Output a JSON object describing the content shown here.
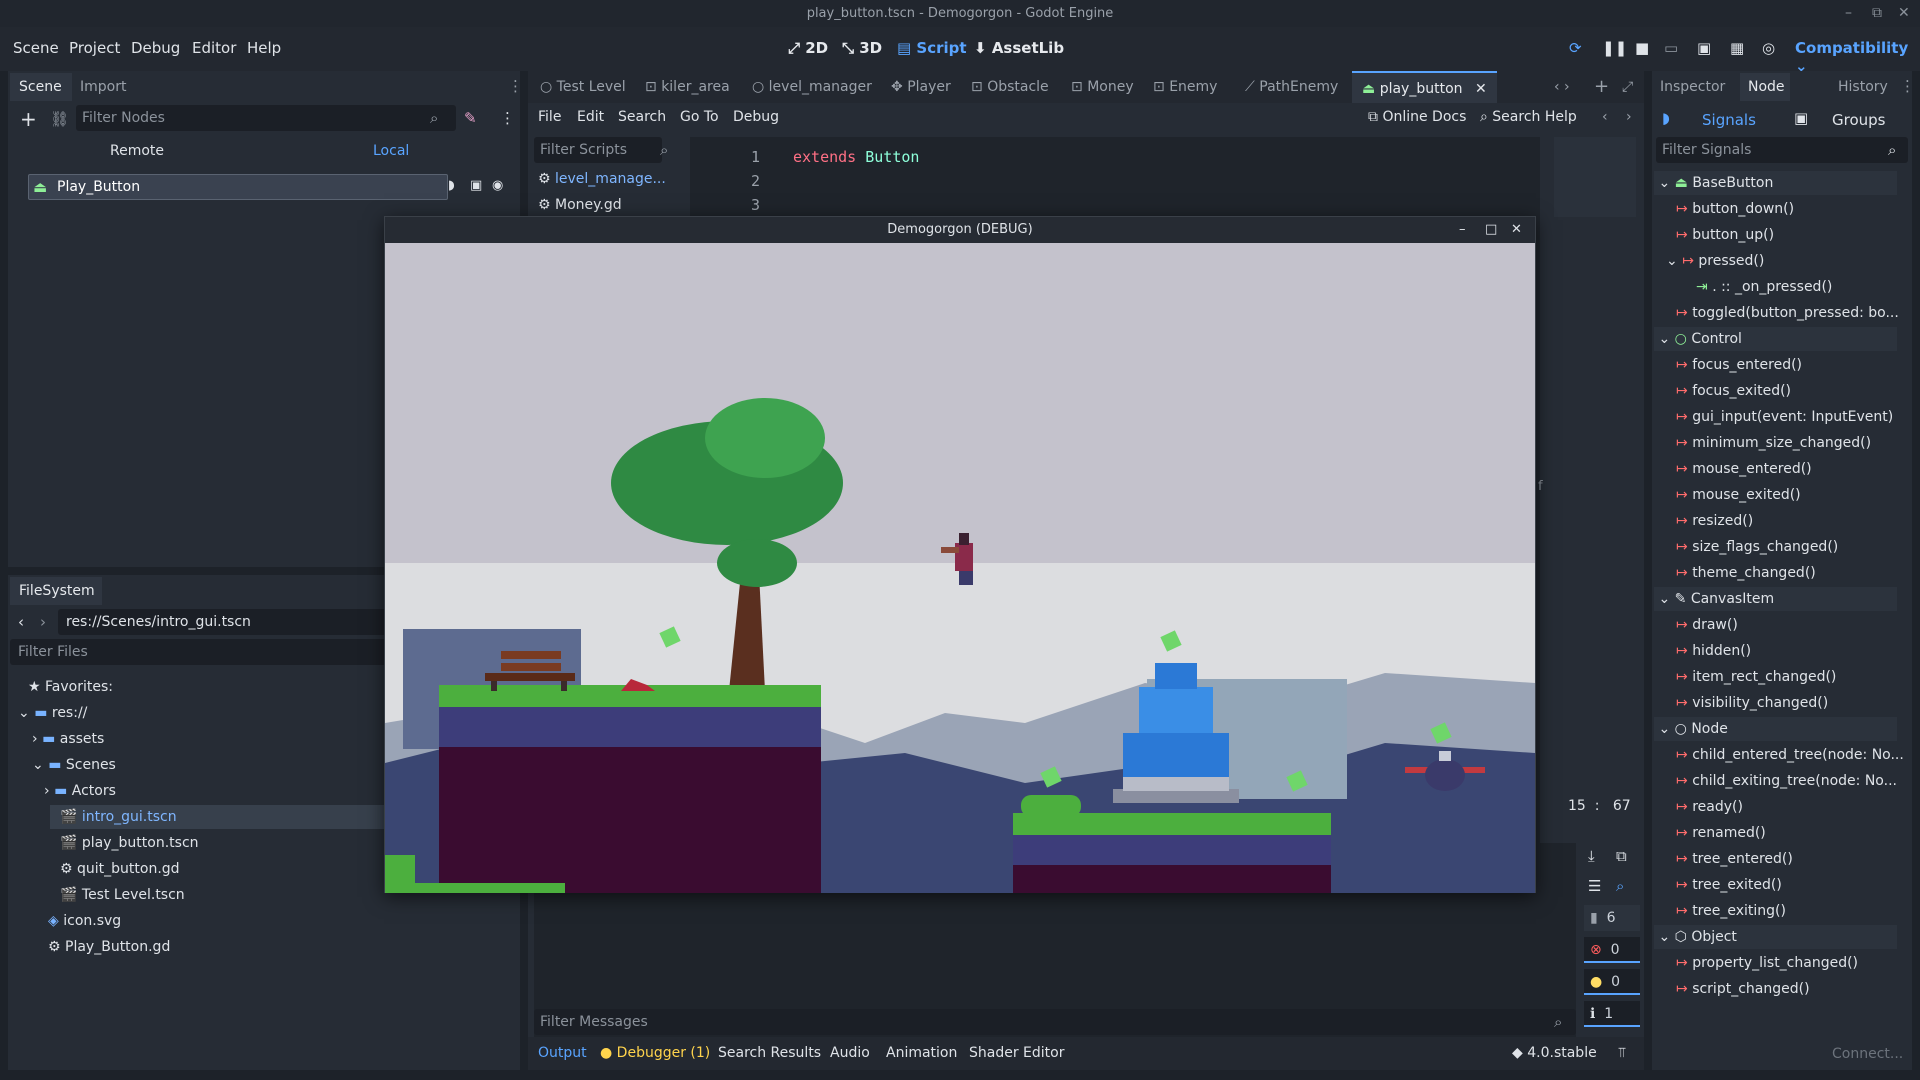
{
  "window": {
    "title": "play_button.tscn - Demogorgon - Godot Engine"
  },
  "menu": [
    "Scene",
    "Project",
    "Debug",
    "Editor",
    "Help"
  ],
  "workspaces": [
    {
      "label": "2D",
      "icon": "2d-icon"
    },
    {
      "label": "3D",
      "icon": "3d-icon"
    },
    {
      "label": "Script",
      "icon": "script-icon"
    },
    {
      "label": "AssetLib",
      "icon": "assetlib-icon"
    }
  ],
  "renderer": "Compatibility",
  "scene_dock": {
    "tabs": [
      "Scene",
      "Import"
    ],
    "filter_placeholder": "Filter Nodes",
    "remote": "Remote",
    "local": "Local",
    "root_node": "Play_Button"
  },
  "filesystem": {
    "tab": "FileSystem",
    "path": "res://Scenes/intro_gui.tscn",
    "filter_placeholder": "Filter Files",
    "items": [
      {
        "label": "Favorites:",
        "indent": 0,
        "icon": "star-icon"
      },
      {
        "label": "res://",
        "indent": 0,
        "icon": "folder-icon"
      },
      {
        "label": "assets",
        "indent": 1,
        "icon": "folder-icon"
      },
      {
        "label": "Scenes",
        "indent": 1,
        "icon": "folder-icon"
      },
      {
        "label": "Actors",
        "indent": 2,
        "icon": "folder-icon"
      },
      {
        "label": "intro_gui.tscn",
        "indent": 2,
        "icon": "scene-file-icon"
      },
      {
        "label": "play_button.tscn",
        "indent": 2,
        "icon": "scene-file-icon"
      },
      {
        "label": "quit_button.gd",
        "indent": 2,
        "icon": "gear-icon"
      },
      {
        "label": "Test Level.tscn",
        "indent": 2,
        "icon": "scene-file-icon"
      },
      {
        "label": "icon.svg",
        "indent": 1,
        "icon": "image-icon"
      },
      {
        "label": "Play_Button.gd",
        "indent": 1,
        "icon": "gear-icon"
      }
    ]
  },
  "script_tabs": [
    "Test Level",
    "kiler_area",
    "level_manager",
    "Player",
    "Obstacle",
    "Money",
    "Enemy",
    "PathEnemy",
    "play_button"
  ],
  "script_menu": [
    "File",
    "Edit",
    "Search",
    "Go To",
    "Debug"
  ],
  "online_docs": "Online Docs",
  "search_help": "Search Help",
  "script_list": {
    "filter_placeholder": "Filter Scripts",
    "items": [
      "level_manage...",
      "Money.gd"
    ]
  },
  "code": {
    "lines": [
      "1",
      "2",
      "3"
    ],
    "line1_keyword": "extends",
    "line1_type": "Button"
  },
  "cursor_pos": {
    "line": "15",
    "sep": ":",
    "col": "67"
  },
  "game_window": {
    "title": "Demogorgon (DEBUG)"
  },
  "debug_counts": [
    "6",
    "0",
    "0",
    "1"
  ],
  "filter_messages": "Filter Messages",
  "bottom_tabs": [
    "Output",
    "Debugger (1)",
    "Search Results",
    "Audio",
    "Animation",
    "Shader Editor"
  ],
  "version": "4.0.stable",
  "inspector": {
    "tabs": [
      "Inspector",
      "Node",
      "History"
    ],
    "signals": "Signals",
    "groups": "Groups",
    "filter_placeholder": "Filter Signals",
    "sections": [
      {
        "name": "BaseButton",
        "items": [
          "button_down()",
          "button_up()",
          "pressed()",
          ". :: _on_pressed()",
          "toggled(button_pressed: bo..."
        ]
      },
      {
        "name": "Control",
        "items": [
          "focus_entered()",
          "focus_exited()",
          "gui_input(event: InputEvent)",
          "minimum_size_changed()",
          "mouse_entered()",
          "mouse_exited()",
          "resized()",
          "size_flags_changed()",
          "theme_changed()"
        ]
      },
      {
        "name": "CanvasItem",
        "items": [
          "draw()",
          "hidden()",
          "item_rect_changed()",
          "visibility_changed()"
        ]
      },
      {
        "name": "Node",
        "items": [
          "child_entered_tree(node: No...",
          "child_exiting_tree(node: No...",
          "ready()",
          "renamed()",
          "tree_entered()",
          "tree_exited()",
          "tree_exiting()"
        ]
      },
      {
        "name": "Object",
        "items": [
          "property_list_changed()",
          "script_changed()"
        ]
      }
    ],
    "connect": "Connect..."
  },
  "colors": {
    "accent": "#59a4ff",
    "sky": "#c4c2cc",
    "grass": "#4caf3e",
    "soil": "#3a0c30",
    "fountain": "#2b79d6"
  }
}
